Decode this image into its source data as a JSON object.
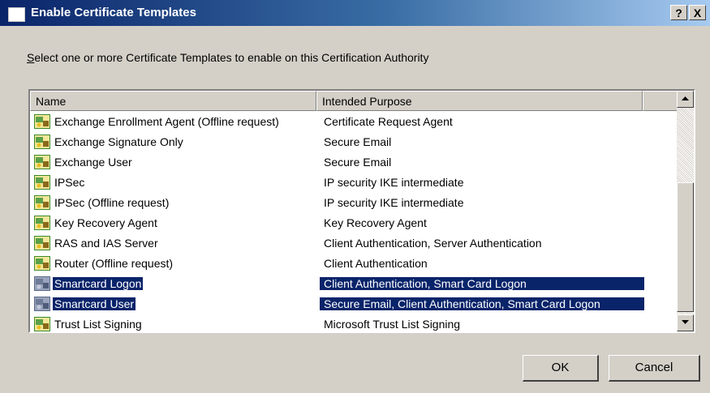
{
  "window": {
    "title": "Enable Certificate Templates",
    "help_button": "?",
    "close_button": "X"
  },
  "instruction": {
    "mnemonic": "S",
    "text": "elect one or more Certificate Templates to enable on this Certification Authority"
  },
  "list": {
    "columns": [
      "Name",
      "Intended Purpose"
    ],
    "rows": [
      {
        "name": "Exchange Enrollment Agent (Offline request)",
        "purpose": "Certificate Request Agent",
        "selected": false
      },
      {
        "name": "Exchange Signature Only",
        "purpose": "Secure Email",
        "selected": false
      },
      {
        "name": "Exchange User",
        "purpose": "Secure Email",
        "selected": false
      },
      {
        "name": "IPSec",
        "purpose": "IP security IKE intermediate",
        "selected": false
      },
      {
        "name": "IPSec (Offline request)",
        "purpose": "IP security IKE intermediate",
        "selected": false
      },
      {
        "name": "Key Recovery Agent",
        "purpose": "Key Recovery Agent",
        "selected": false
      },
      {
        "name": "RAS and IAS Server",
        "purpose": "Client Authentication, Server Authentication",
        "selected": false
      },
      {
        "name": "Router (Offline request)",
        "purpose": "Client Authentication",
        "selected": false
      },
      {
        "name": "Smartcard Logon",
        "purpose": "Client Authentication, Smart Card Logon",
        "selected": true
      },
      {
        "name": "Smartcard User",
        "purpose": "Secure Email, Client Authentication, Smart Card Logon",
        "selected": true
      },
      {
        "name": "Trust List Signing",
        "purpose": "Microsoft Trust List Signing",
        "selected": false
      }
    ]
  },
  "buttons": {
    "ok": "OK",
    "cancel": "Cancel"
  },
  "colors": {
    "selection": "#0a246a",
    "title_gradient_start": "#0a246a",
    "dialog_face": "#d4d0c8"
  },
  "icons": {
    "row_icon": "certificate-template-icon",
    "scroll_up": "arrow-up-icon",
    "scroll_down": "arrow-down-icon"
  }
}
